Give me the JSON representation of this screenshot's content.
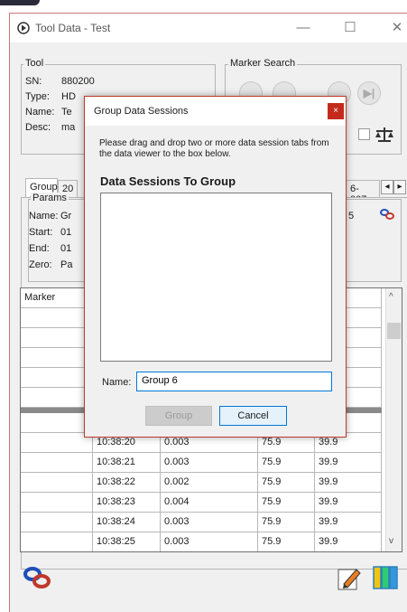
{
  "window": {
    "title": "Tool Data - Test",
    "minimize": "—",
    "maximize": "☐",
    "close": "✕"
  },
  "tool": {
    "group_label": "Tool",
    "sn_label": "SN:",
    "sn_value": "880200",
    "type_label": "Type:",
    "type_value": "HD",
    "name_label": "Name:",
    "name_value": "Te",
    "desc_label": "Desc:",
    "desc_value": "ma"
  },
  "marker_search": {
    "label": "Marker Search",
    "last_icon": "▶|"
  },
  "tabs": {
    "active": "Group 6",
    "second": "20",
    "right": "6-007",
    "left_arrow": "◂",
    "right_arrow": "▸"
  },
  "params": {
    "label": "Params",
    "name_label": "Name:",
    "name_value": "Gr",
    "start_label": "Start:",
    "start_value": "01",
    "end_label": "End:",
    "end_value": "01",
    "zero_label": "Zero:",
    "zero_value": "Pa",
    "right_value": "5"
  },
  "grid": {
    "col_marker": "Marker",
    "col_pct": "(%)",
    "rows": [
      {
        "time": "10:38:20",
        "val": "0.003",
        "a": "75.9",
        "b": "39.9"
      },
      {
        "time": "10:38:21",
        "val": "0.003",
        "a": "75.9",
        "b": "39.9"
      },
      {
        "time": "10:38:22",
        "val": "0.002",
        "a": "75.9",
        "b": "39.9"
      },
      {
        "time": "10:38:23",
        "val": "0.004",
        "a": "75.9",
        "b": "39.9"
      },
      {
        "time": "10:38:24",
        "val": "0.003",
        "a": "75.9",
        "b": "39.9"
      },
      {
        "time": "10:38:25",
        "val": "0.003",
        "a": "75.9",
        "b": "39.9"
      }
    ]
  },
  "dialog": {
    "title": "Group Data Sessions",
    "close": "×",
    "instructions": "Please drag and drop two or more data session tabs from the data viewer to the box below.",
    "heading": "Data Sessions To Group",
    "name_label": "Name:",
    "name_value": "Group 6",
    "group_button": "Group",
    "cancel_button": "Cancel"
  },
  "colors": {
    "accent": "#0078d7",
    "dialog_border": "#c0392b",
    "close_red": "#c42b1c"
  },
  "icons": [
    "app-icon",
    "scale-icon",
    "link-icon",
    "edit-icon",
    "columns-icon"
  ]
}
